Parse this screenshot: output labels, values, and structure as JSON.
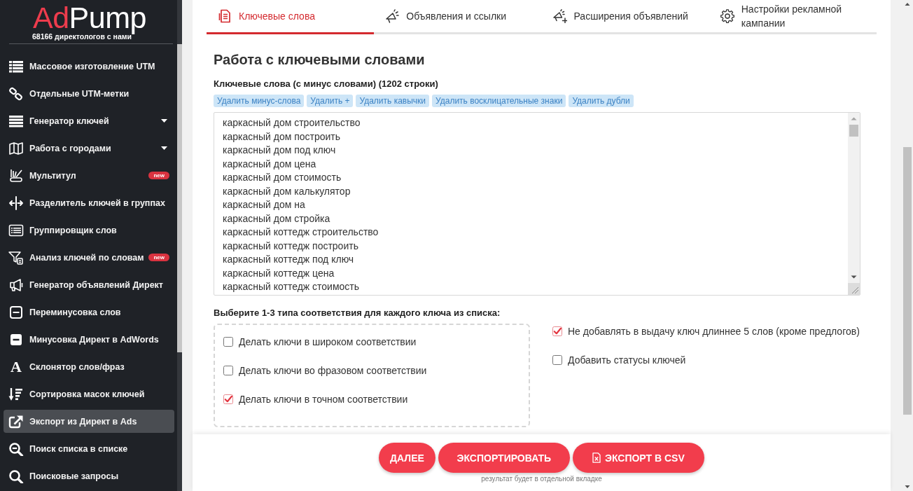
{
  "sidebar": {
    "logo": {
      "accent": "Ad",
      "rest": "Pump"
    },
    "tagline": "68166 директологов с нами",
    "items": [
      {
        "label": "Массовое изготовление UTM",
        "kind": "link",
        "selected": false
      },
      {
        "label": "Отдельные UTM-метки",
        "kind": "link",
        "selected": false
      },
      {
        "label": "Генератор ключей",
        "kind": "submenu",
        "selected": false
      },
      {
        "label": "Работа с городами",
        "kind": "submenu",
        "selected": false
      },
      {
        "label": "Мультитул",
        "kind": "link",
        "selected": false,
        "badge": "new"
      },
      {
        "label": "Разделитель ключей в группах",
        "kind": "link",
        "selected": false
      },
      {
        "label": "Группировщик слов",
        "kind": "link",
        "selected": false
      },
      {
        "label": "Анализ ключей по словам",
        "kind": "link",
        "selected": false,
        "badge": "new"
      },
      {
        "label": "Генератор объявлений Директ",
        "kind": "link",
        "selected": false
      },
      {
        "label": "Переминусовка слов",
        "kind": "link",
        "selected": false
      },
      {
        "label": "Минусовка Директ в AdWords",
        "kind": "link",
        "selected": false
      },
      {
        "label": "Склонятор слов/фраз",
        "kind": "link",
        "selected": false,
        "glyph": "A"
      },
      {
        "label": "Сортировка масок ключей",
        "kind": "link",
        "selected": false
      },
      {
        "label": "Экспорт из Директ в Ads",
        "kind": "link",
        "selected": true
      },
      {
        "label": "Поиск списка в списке",
        "kind": "link",
        "selected": false
      },
      {
        "label": "Поисковые запросы",
        "kind": "link",
        "selected": false
      }
    ]
  },
  "tabs": [
    {
      "label": "Ключевые слова",
      "selected": true
    },
    {
      "label": "Объявления и ссылки",
      "selected": false
    },
    {
      "label": "Расширения объявлений",
      "selected": false
    },
    {
      "label": "Настройки рекламной кампании",
      "selected": false
    }
  ],
  "keywords": {
    "title": "Работа с ключевыми словами",
    "label": "Ключевые слова (с минус словами) (1202 строки)",
    "actions": [
      "Удалить минус-слова",
      "Удалить +",
      "Удалить кавычки",
      "Удалить восклицательные знаки",
      "Удалить дубли"
    ],
    "lines": [
      "каркасный дом строительство",
      "каркасный дом построить",
      "каркасный дом под ключ",
      "каркасный дом цена",
      "каркасный дом стоимость",
      "каркасный дом калькулятор",
      "каркасный дом на",
      "каркасный дом стройка",
      "каркасный коттедж строительство",
      "каркасный коттедж построить",
      "каркасный коттедж под ключ",
      "каркасный коттедж цена",
      "каркасный коттедж стоимость"
    ]
  },
  "match_types": {
    "label": "Выберите 1-3 типа соответствия для каждого ключа из списка:",
    "options": [
      {
        "label": "Делать ключи в широком соответствии",
        "checked": false
      },
      {
        "label": "Делать ключи во фразовом соответствии",
        "checked": false
      },
      {
        "label": "Делать ключи в точном соответствии",
        "checked": true
      }
    ],
    "extra_options": [
      {
        "label": "Не добавлять в выдачу ключ длиннее 5 слов (кроме предлогов)",
        "checked": true
      },
      {
        "label": "Добавить статусы ключей",
        "checked": false
      }
    ]
  },
  "footer": {
    "buttons": [
      {
        "label": "ДАЛЕЕ",
        "kind": "text"
      },
      {
        "label": "ЭКСПОРТИРОВАТЬ",
        "kind": "text"
      },
      {
        "label": "ЭКСПОРТ В CSV",
        "kind": "file"
      }
    ],
    "note": "результат будет в отдельной вкладке"
  }
}
